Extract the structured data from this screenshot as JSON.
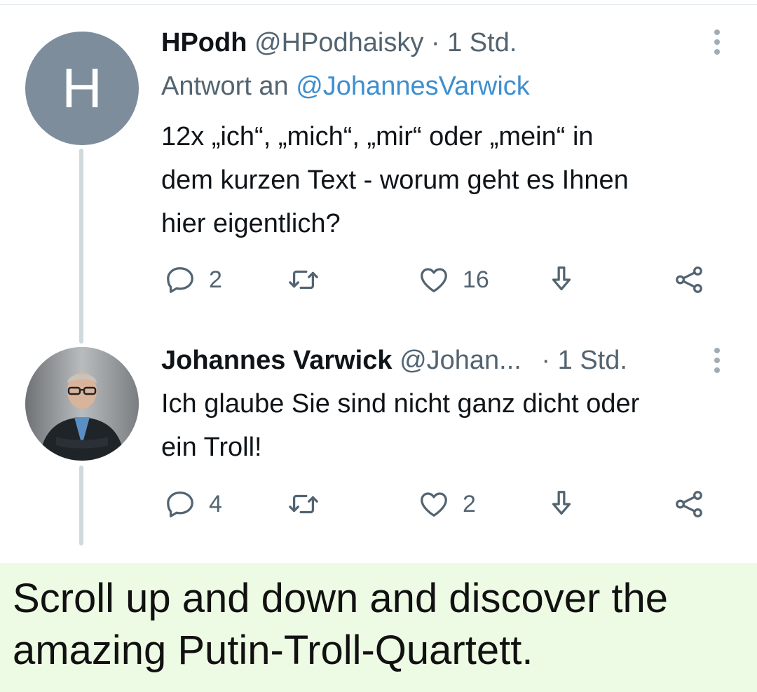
{
  "tweets": [
    {
      "avatar_letter": "H",
      "name": "HPodh",
      "handle": "@HPodhaisky",
      "time": "· 1 Std.",
      "reply_prefix": "Antwort an",
      "reply_handle": "@JohannesVarwick",
      "text_lines": [
        "12x „ich“, „mich“, „mir“ oder „mein“  in",
        "dem kurzen Text - worum geht es Ihnen",
        "hier eigentlich?"
      ],
      "replies": "2",
      "retweets": "",
      "likes": "16"
    },
    {
      "name": "Johannes Varwick",
      "handle": "@Johan...",
      "time": "· 1 Std.",
      "text_lines": [
        "Ich glaube Sie sind nicht ganz dicht oder",
        "ein Troll!"
      ],
      "replies": "4",
      "retweets": "",
      "likes": "2"
    }
  ],
  "caption": {
    "line1": "Scroll up and down and discover the",
    "line2": "amazing Putin-Troll-Quartett."
  },
  "icons": {
    "reply": "reply-icon",
    "retweet": "retweet-icon",
    "like": "heart-icon",
    "save": "download-icon",
    "share": "share-icon",
    "more": "more-vertical-icon"
  },
  "colors": {
    "link": "#3e8fd0",
    "muted": "#536471",
    "caption_bg": "#eefbe4",
    "avatar_bg": "#7d8d9c"
  }
}
